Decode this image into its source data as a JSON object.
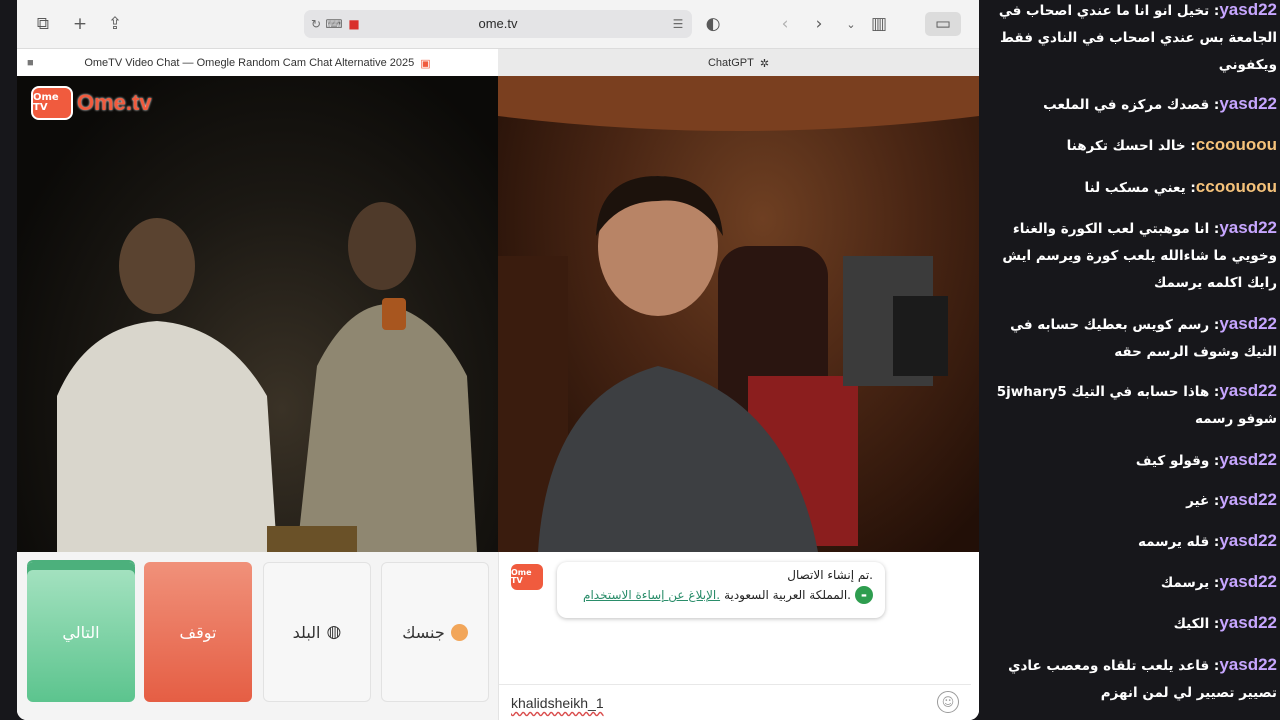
{
  "browser": {
    "url": "ome.tv",
    "tabs": [
      {
        "title": "OmeTV Video Chat — Omegle Random Cam Chat Alternative 2025"
      },
      {
        "title": "ChatGPT"
      }
    ]
  },
  "ometv": {
    "logo_small": "Ome TV",
    "logo_text": "Ome.tv",
    "buttons": {
      "next": "التالي",
      "stop": "توقف",
      "country": "البلد",
      "gender": "جنسك"
    },
    "chat": {
      "logo": "Ome TV",
      "connected": ".تم إنشاء الاتصال",
      "country": ".المملكة العربية السعودية",
      "report_link": ".الإبلاغ عن إساءة الاستخدام",
      "input_value": "khalidsheikh_1"
    }
  },
  "stream_chat": [
    {
      "user": "yasd22",
      "text": "تخيل انو انا ما عندي اصحاب في الجامعة بس عندي اصحاب في النادي فقط ويكفوني",
      "color": "#c7a6ff"
    },
    {
      "user": "yasd22",
      "text": "قصدك مركزه في الملعب",
      "color": "#c7a6ff"
    },
    {
      "user": "ccoouoou",
      "text": "خالد احسك تكرهنا",
      "color": "#f5c27a"
    },
    {
      "user": "ccoouoou",
      "text": "يعني مسكب لنا",
      "color": "#f5c27a"
    },
    {
      "user": "yasd22",
      "text": "انا موهبتي لعب الكورة والغناء وخويي ما شاءالله يلعب كورة ويرسم ايش رايك اكلمه يرسمك",
      "color": "#c7a6ff"
    },
    {
      "user": "yasd22",
      "text": "رسم كويس بعطيك حسابه في التيك وشوف الرسم حقه",
      "color": "#c7a6ff"
    },
    {
      "user": "yasd22",
      "text": "هاذا حسابه في التيك 5jwhary5 شوفو رسمه",
      "color": "#c7a6ff"
    },
    {
      "user": "yasd22",
      "text": "وقولو كيف",
      "color": "#c7a6ff"
    },
    {
      "user": "yasd22",
      "text": "غير",
      "color": "#c7a6ff"
    },
    {
      "user": "yasd22",
      "text": "قله يرسمه",
      "color": "#c7a6ff"
    },
    {
      "user": "yasd22",
      "text": "يرسمك",
      "color": "#c7a6ff"
    },
    {
      "user": "yasd22",
      "text": "الكيك",
      "color": "#c7a6ff"
    },
    {
      "user": "yasd22",
      "text": "قاعد يلعب تلقاه ومعصب عادي تصيير تصيير لي لمن انهزم",
      "color": "#c7a6ff"
    }
  ]
}
